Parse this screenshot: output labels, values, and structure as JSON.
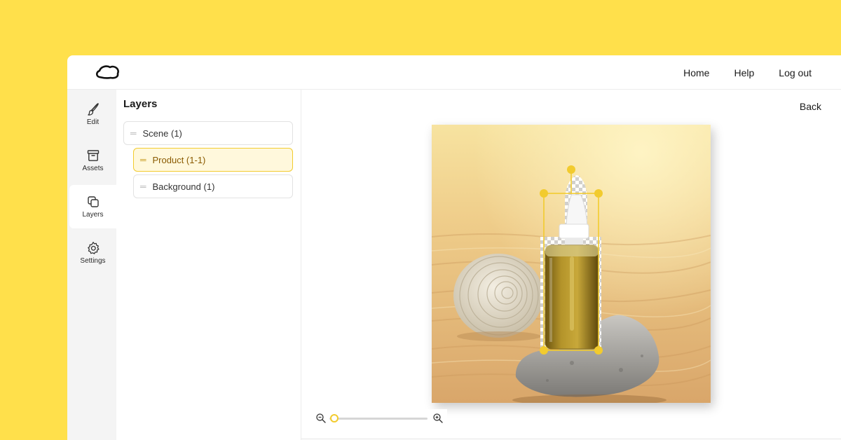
{
  "nav": {
    "home": "Home",
    "help": "Help",
    "logout": "Log out"
  },
  "rail": {
    "items": [
      {
        "label": "Edit",
        "icon": "brush-icon"
      },
      {
        "label": "Assets",
        "icon": "archive-box-icon"
      },
      {
        "label": "Layers",
        "icon": "layers-icon",
        "active": true
      },
      {
        "label": "Settings",
        "icon": "gear-icon"
      }
    ]
  },
  "layers": {
    "title": "Layers",
    "items": [
      {
        "label": "Scene (1)"
      },
      {
        "label": "Product (1-1)",
        "selected": true
      },
      {
        "label": "Background (1)"
      }
    ]
  },
  "canvas": {
    "back_label": "Back",
    "zoom_level": 0.05
  },
  "colors": {
    "background": "#FFE04B",
    "accent": "#F2CB2E",
    "selected_fill": "#FFF8DC",
    "selected_text": "#8a5a00"
  }
}
